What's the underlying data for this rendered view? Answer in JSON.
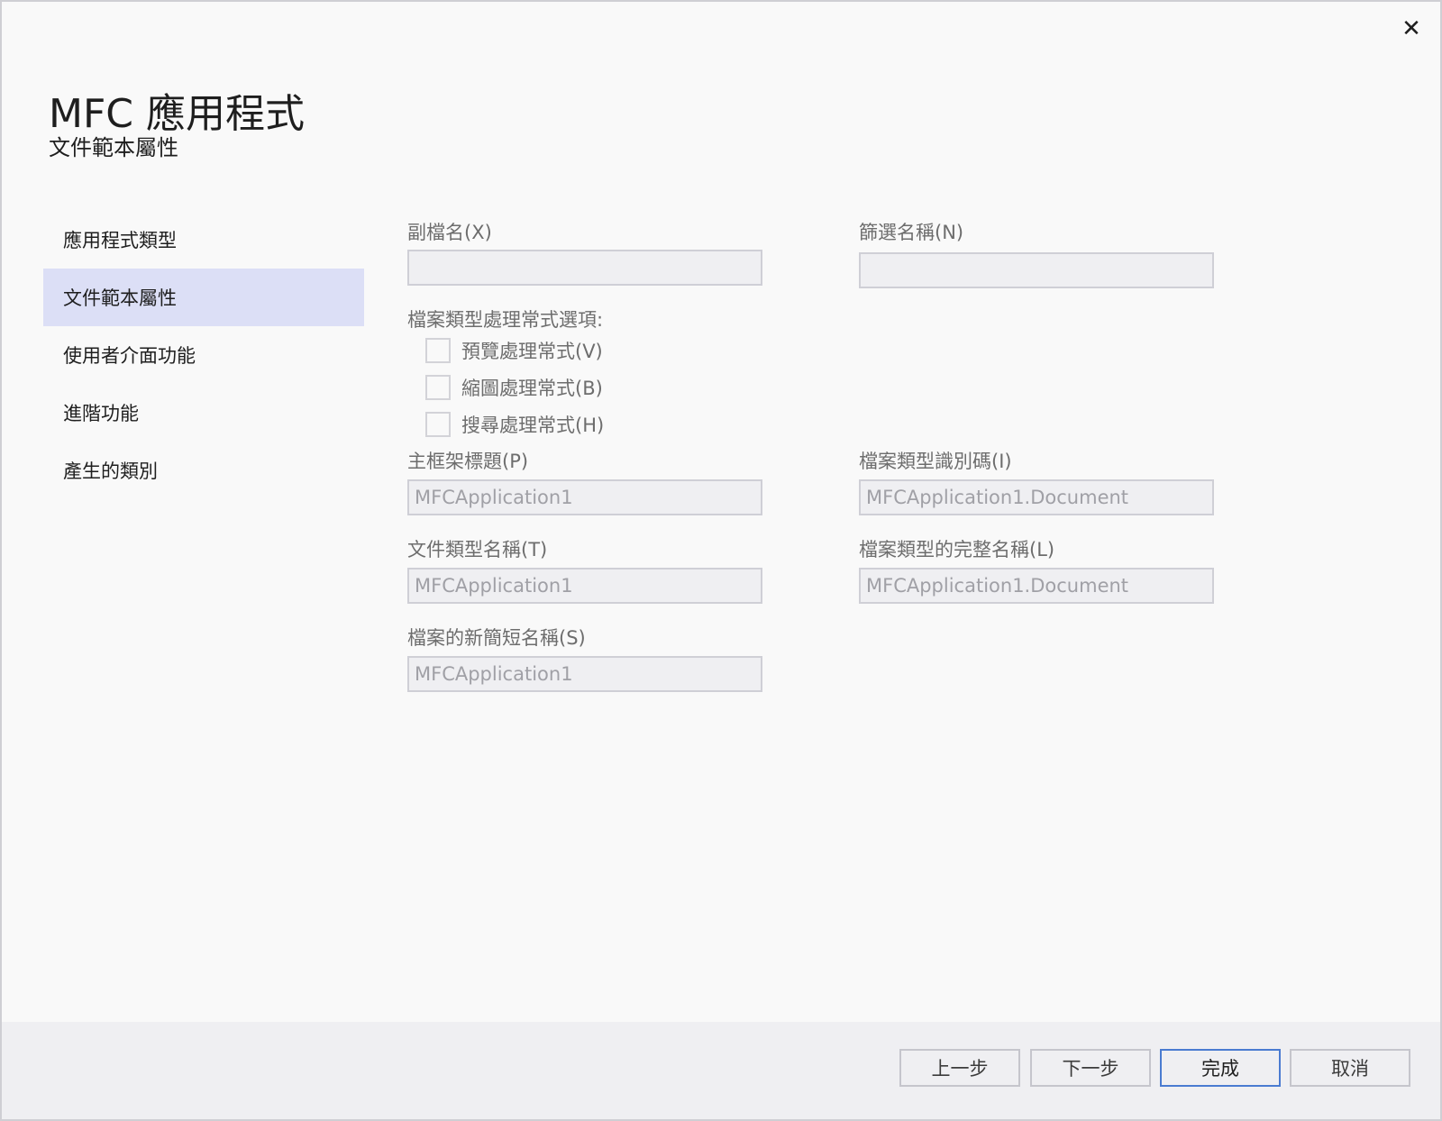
{
  "window": {
    "close_icon": "close-icon"
  },
  "header": {
    "title": "MFC 應用程式",
    "subtitle": "文件範本屬性"
  },
  "sidebar": {
    "items": [
      {
        "label": "應用程式類型"
      },
      {
        "label": "文件範本屬性",
        "selected": true
      },
      {
        "label": "使用者介面功能"
      },
      {
        "label": "進階功能"
      },
      {
        "label": "產生的類別"
      }
    ]
  },
  "form": {
    "extension": {
      "label": "副檔名(X)",
      "value": ""
    },
    "filter_name": {
      "label": "篩選名稱(N)",
      "value": ""
    },
    "handler_options": {
      "label": "檔案類型處理常式選項:",
      "preview": {
        "label": "預覽處理常式(V)",
        "checked": false
      },
      "thumbnail": {
        "label": "縮圖處理常式(B)",
        "checked": false
      },
      "search": {
        "label": "搜尋處理常式(H)",
        "checked": false
      }
    },
    "main_frame_caption": {
      "label": "主框架標題(P)",
      "value": "MFCApplication1"
    },
    "file_type_id": {
      "label": "檔案類型識別碼(I)",
      "value": "MFCApplication1.Document"
    },
    "doc_type_name": {
      "label": "文件類型名稱(T)",
      "value": "MFCApplication1"
    },
    "file_type_full_name": {
      "label": "檔案類型的完整名稱(L)",
      "value": "MFCApplication1.Document"
    },
    "file_new_short_name": {
      "label": "檔案的新簡短名稱(S)",
      "value": "MFCApplication1"
    }
  },
  "footer": {
    "back_label": "上一步",
    "next_label": "下一步",
    "finish_label": "完成",
    "cancel_label": "取消"
  }
}
